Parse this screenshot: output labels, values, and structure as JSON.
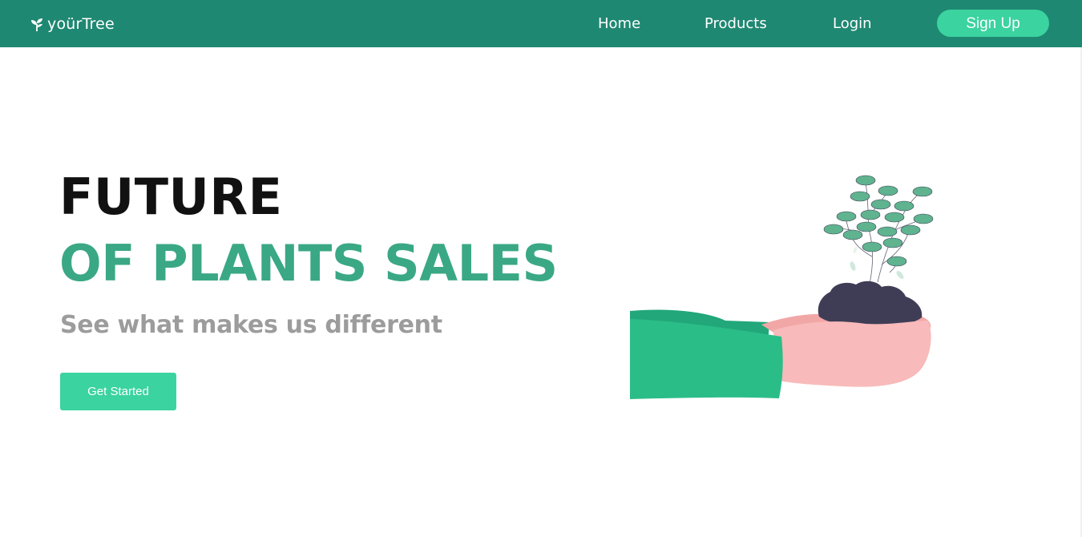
{
  "brand": {
    "name": "yoürTree",
    "logo_icon": "leaf-icon"
  },
  "nav": {
    "home": "Home",
    "products": "Products",
    "login": "Login",
    "signup": "Sign Up"
  },
  "hero": {
    "title_line1": "FUTURE",
    "title_line2": "OF PLANTS SALES",
    "subtitle": "See what makes us different",
    "cta_label": "Get Started"
  },
  "colors": {
    "navbar": "#1f8872",
    "accent": "#3bd39f",
    "title_green": "#3aa884",
    "subtitle_gray": "#9c9c9c"
  },
  "illustration": {
    "description_icon": "hands-holding-plant-illustration"
  }
}
